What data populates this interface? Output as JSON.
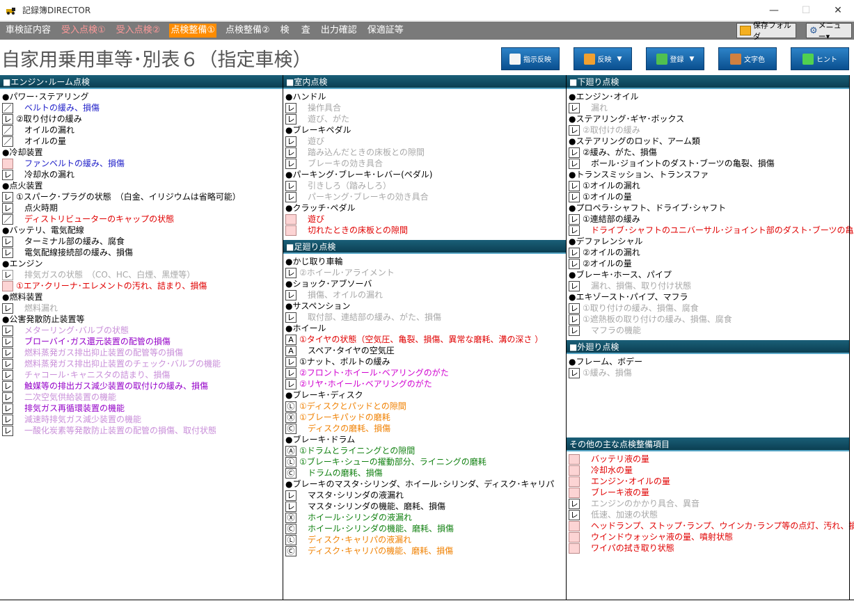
{
  "window": {
    "title": "記録簿DIRECTOR",
    "controls": [
      "—",
      "☐",
      "✕"
    ]
  },
  "menu": {
    "items": [
      {
        "label": "車検証内容",
        "style": "white"
      },
      {
        "label": "受入点検①",
        "style": "red"
      },
      {
        "label": "受入点検②",
        "style": "red"
      },
      {
        "label": "点検整備①",
        "style": "active"
      },
      {
        "label": "点検整備②",
        "style": "white"
      },
      {
        "label": "検　 査",
        "style": "white"
      },
      {
        "label": "出力確認",
        "style": "white"
      },
      {
        "label": "保適証等",
        "style": "white"
      }
    ],
    "folder_button": "保存フォルダ",
    "menu_button": "メニュー▾"
  },
  "page": {
    "title": "自家用乗用車等･別表６（指定車検）"
  },
  "toolbar": [
    {
      "label": "指示反映",
      "icon": "edit-icon",
      "color": "#f5f5f5",
      "dropdown": false
    },
    {
      "label": "反映",
      "icon": "rss-icon",
      "color": "#f0a030",
      "dropdown": true
    },
    {
      "label": "登録",
      "icon": "rss-icon",
      "color": "#50c050",
      "dropdown": true
    },
    {
      "label": "文字色",
      "icon": "palette-icon",
      "color": "#d08040",
      "dropdown": false
    },
    {
      "label": "ヒント",
      "icon": "chat-icon",
      "color": "#50d050",
      "dropdown": false
    }
  ],
  "columns": [
    [
      {
        "title": "■エンジン･ルーム点検",
        "groups": [
          {
            "label": "●パワー･ステアリング",
            "items": [
              {
                "mark": "／",
                "box": "n",
                "text": "　ベルトの緩み、損傷",
                "color": "blue"
              },
              {
                "mark": "レ",
                "box": "n",
                "text": "②取り付けの緩み",
                "color": "black"
              },
              {
                "mark": "／",
                "box": "n",
                "text": "　オイルの漏れ",
                "color": "black"
              },
              {
                "mark": "／",
                "box": "n",
                "text": "　オイルの量",
                "color": "black"
              }
            ]
          },
          {
            "label": "●冷却装置",
            "items": [
              {
                "mark": "",
                "box": "p",
                "text": "　ファンベルトの緩み、損傷",
                "color": "blue"
              },
              {
                "mark": "レ",
                "box": "n",
                "text": "　冷却水の漏れ",
                "color": "black"
              }
            ]
          },
          {
            "label": "●点火装置",
            "items": [
              {
                "mark": "レ",
                "box": "n",
                "text": "①スパーク･プラグの状態　（白金、イリジウムは省略可能）",
                "color": "black"
              },
              {
                "mark": "レ",
                "box": "n",
                "text": "　点火時期",
                "color": "black"
              },
              {
                "mark": "／",
                "box": "n",
                "text": "　ディストリビューターのキャップの状態",
                "color": "red"
              }
            ]
          },
          {
            "label": "●バッテリ、電気配線",
            "items": [
              {
                "mark": "レ",
                "box": "n",
                "text": "　ターミナル部の緩み、腐食",
                "color": "black"
              },
              {
                "mark": "レ",
                "box": "n",
                "text": "　電気配線接続部の緩み、損傷",
                "color": "black"
              }
            ]
          },
          {
            "label": "●エンジン",
            "items": [
              {
                "mark": "レ",
                "box": "l",
                "text": "　排気ガスの状態　（CO、HC、白煙、黒煙等）",
                "color": "gray"
              },
              {
                "mark": "",
                "box": "p",
                "text": "①エア･クリーナ･エレメントの汚れ、詰まり、損傷",
                "color": "red"
              }
            ]
          },
          {
            "label": "●燃料装置",
            "items": [
              {
                "mark": "レ",
                "box": "n",
                "text": "　燃料漏れ",
                "color": "gray"
              }
            ]
          },
          {
            "label": "●公害発散防止装置等",
            "items": [
              {
                "mark": "レ",
                "box": "n",
                "text": "　メターリング･バルブの状態",
                "color": "lpurple"
              },
              {
                "mark": "レ",
                "box": "n",
                "text": "　ブローバイ･ガス還元装置の配管の損傷",
                "color": "purple"
              },
              {
                "mark": "レ",
                "box": "n",
                "text": "　燃料蒸発ガス排出抑止装置の配管等の損傷",
                "color": "lpurple"
              },
              {
                "mark": "レ",
                "box": "n",
                "text": "　燃料蒸発ガス排出抑止装置のチェック･バルブの機能",
                "color": "lpurple"
              },
              {
                "mark": "レ",
                "box": "n",
                "text": "　チャコール･キャニスタの詰まり、損傷",
                "color": "lpurple"
              },
              {
                "mark": "レ",
                "box": "n",
                "text": "　触媒等の排出ガス減少装置の取付けの緩み、損傷",
                "color": "purple"
              },
              {
                "mark": "レ",
                "box": "n",
                "text": "　二次空気供給装置の機能",
                "color": "lpurple"
              },
              {
                "mark": "レ",
                "box": "n",
                "text": "　排気ガス再循環装置の機能",
                "color": "purple"
              },
              {
                "mark": "レ",
                "box": "n",
                "text": "　減速時排気ガス減少装置の機能",
                "color": "lpurple"
              },
              {
                "mark": "レ",
                "box": "n",
                "text": "　一酸化炭素等発散防止装置の配管の損傷、取付状態",
                "color": "lpurple"
              }
            ]
          }
        ]
      }
    ],
    [
      {
        "title": "■室内点検",
        "groups": [
          {
            "label": "●ハンドル",
            "items": [
              {
                "mark": "レ",
                "box": "n",
                "text": "　操作具合",
                "color": "gray"
              },
              {
                "mark": "レ",
                "box": "n",
                "text": "　遊び、がた",
                "color": "gray"
              }
            ]
          },
          {
            "label": "●ブレーキペダル",
            "items": [
              {
                "mark": "レ",
                "box": "n",
                "text": "　遊び",
                "color": "gray"
              },
              {
                "mark": "レ",
                "box": "n",
                "text": "　踏み込んだときの床板との隙間",
                "color": "gray"
              },
              {
                "mark": "レ",
                "box": "n",
                "text": "　ブレーキの効き具合",
                "color": "gray"
              }
            ]
          },
          {
            "label": "●パーキング･ブレーキ･レバー(ペダル)",
            "items": [
              {
                "mark": "レ",
                "box": "n",
                "text": "　引きしろ（踏みしろ）",
                "color": "gray"
              },
              {
                "mark": "レ",
                "box": "n",
                "text": "　パーキング･ブレーキの効き具合",
                "color": "gray"
              }
            ]
          },
          {
            "label": "●クラッチ･ペダル",
            "items": [
              {
                "mark": "",
                "box": "p",
                "text": "　遊び",
                "color": "red"
              },
              {
                "mark": "",
                "box": "p",
                "text": "　切れたときの床板との隙間",
                "color": "red"
              }
            ]
          }
        ]
      },
      {
        "title": "■足廻り点検",
        "groups": [
          {
            "label": "●かじ取り車輪",
            "items": [
              {
                "mark": "レ",
                "box": "n",
                "text": "②ホイール･アライメント",
                "color": "gray"
              }
            ]
          },
          {
            "label": "●ショック･アブソーバ",
            "items": [
              {
                "mark": "レ",
                "box": "n",
                "text": "　損傷、オイルの漏れ",
                "color": "gray"
              }
            ]
          },
          {
            "label": "●サスペンション",
            "items": [
              {
                "mark": "レ",
                "box": "n",
                "text": "　取付部、連結部の緩み、がた、損傷",
                "color": "gray"
              }
            ]
          },
          {
            "label": "●ホイール",
            "items": [
              {
                "mark": "A",
                "box": "n",
                "text": "①タイヤの状態（空気圧、亀裂、損傷、異常な磨耗、溝の深さ ）",
                "color": "red"
              },
              {
                "mark": "A",
                "box": "n",
                "text": "　スペア･タイヤの空気圧",
                "color": "black"
              },
              {
                "mark": "レ",
                "box": "n",
                "text": "①ナット、ボルトの緩み",
                "color": "black"
              },
              {
                "mark": "レ",
                "box": "n",
                "text": "②フロント･ホイール･ベアリングのがた",
                "color": "magenta"
              },
              {
                "mark": "レ",
                "box": "n",
                "text": "②リヤ･ホイール･ベアリングのがた",
                "color": "magenta"
              }
            ]
          },
          {
            "label": "●ブレーキ･ディスク",
            "items": [
              {
                "mark": "Ⓛ",
                "box": "n",
                "text": "①ディスクとパッドとの隙間",
                "color": "orange"
              },
              {
                "mark": "Ⓧ",
                "box": "n",
                "text": "①ブレーキパッドの磨耗",
                "color": "orange"
              },
              {
                "mark": "Ⓒ",
                "box": "n",
                "text": "　ディスクの磨耗、損傷",
                "color": "orange"
              }
            ]
          },
          {
            "label": "●ブレーキ･ドラム",
            "items": [
              {
                "mark": "Ⓐ",
                "box": "n",
                "text": "①ドラムとライニングとの隙間",
                "color": "green"
              },
              {
                "mark": "Ⓛ",
                "box": "n",
                "text": "①ブレーキ･シューの擢動部分、ライニングの磨耗",
                "color": "green"
              },
              {
                "mark": "Ⓒ",
                "box": "n",
                "text": "　ドラムの磨耗、損傷",
                "color": "green"
              }
            ]
          },
          {
            "label": "●ブレーキのマスタ･シリンダ、ホイール･シリンダ、ディスク･キャリパ",
            "items": [
              {
                "mark": "レ",
                "box": "n",
                "text": "　マスタ･シリンダの液漏れ",
                "color": "black"
              },
              {
                "mark": "レ",
                "box": "n",
                "text": "　マスタ･シリンダの機能、磨耗、損傷",
                "color": "black"
              },
              {
                "mark": "Ⓧ",
                "box": "n",
                "text": "　ホイール･シリンダの液漏れ",
                "color": "green"
              },
              {
                "mark": "Ⓒ",
                "box": "n",
                "text": "　ホイール･シリンダの機能、磨耗、損傷",
                "color": "green"
              },
              {
                "mark": "Ⓛ",
                "box": "n",
                "text": "　ディスク･キャリパの液漏れ",
                "color": "orange"
              },
              {
                "mark": "Ⓒ",
                "box": "n",
                "text": "　ディスク･キャリパの機能、磨耗、損傷",
                "color": "orange"
              }
            ]
          }
        ]
      }
    ],
    [
      {
        "title": "■下廻り点検",
        "groups": [
          {
            "label": "●エンジン･オイル",
            "items": [
              {
                "mark": "レ",
                "box": "n",
                "text": "　漏れ",
                "color": "gray"
              }
            ]
          },
          {
            "label": "●ステアリング･ギヤ･ボックス",
            "items": [
              {
                "mark": "レ",
                "box": "n",
                "text": "②取付けの緩み",
                "color": "gray"
              }
            ]
          },
          {
            "label": "●ステアリングのロッド、アーム類",
            "items": [
              {
                "mark": "レ",
                "box": "n",
                "text": "②緩み、がた、損傷",
                "color": "black"
              },
              {
                "mark": "レ",
                "box": "n",
                "text": "　ボール･ジョイントのダスト･ブーツの亀裂、損傷",
                "color": "black"
              }
            ]
          },
          {
            "label": "●トランスミッション、トランスファ",
            "items": [
              {
                "mark": "レ",
                "box": "n",
                "text": "①オイルの漏れ",
                "color": "black"
              },
              {
                "mark": "レ",
                "box": "n",
                "text": "①オイルの量",
                "color": "black"
              }
            ]
          },
          {
            "label": "●プロペラ･シャフト、ドライブ･シャフト",
            "items": [
              {
                "mark": "レ",
                "box": "n",
                "text": "①連結部の緩み",
                "color": "black"
              },
              {
                "mark": "レ",
                "box": "n",
                "text": "　ドライブ･シャフトのユニバーサル･ジョイント部のダスト･ブーツの亀裂、損傷",
                "color": "red"
              }
            ]
          },
          {
            "label": "●デファレンシャル",
            "items": [
              {
                "mark": "レ",
                "box": "n",
                "text": "②オイルの漏れ",
                "color": "black"
              },
              {
                "mark": "レ",
                "box": "n",
                "text": "②オイルの量",
                "color": "black"
              }
            ]
          },
          {
            "label": "●ブレーキ･ホース、パイプ",
            "items": [
              {
                "mark": "レ",
                "box": "n",
                "text": "　漏れ、損傷、取り付け状態",
                "color": "gray"
              }
            ]
          },
          {
            "label": "●エキゾースト･パイプ、マフラ",
            "items": [
              {
                "mark": "レ",
                "box": "n",
                "text": "①取り付けの緩み、損傷、腐食",
                "color": "gray"
              },
              {
                "mark": "レ",
                "box": "n",
                "text": "①遮熱板の取り付けの緩み、損傷、腐食",
                "color": "gray"
              },
              {
                "mark": "レ",
                "box": "n",
                "text": "　マフラの機能",
                "color": "gray"
              }
            ]
          }
        ]
      },
      {
        "title": "■外廻り点検",
        "groups": [
          {
            "label": "●フレーム、ボデー",
            "items": [
              {
                "mark": "レ",
                "box": "n",
                "text": "①緩み、損傷",
                "color": "gray"
              }
            ]
          }
        ]
      },
      {
        "title": "その他の主な点検整備項目",
        "groups": [
          {
            "label": "",
            "items": [
              {
                "mark": "",
                "box": "p",
                "text": "　バッテリ液の量",
                "color": "red"
              },
              {
                "mark": "",
                "box": "p",
                "text": "　冷却水の量",
                "color": "red"
              },
              {
                "mark": "",
                "box": "p",
                "text": "　エンジン･オイルの量",
                "color": "red"
              },
              {
                "mark": "",
                "box": "p",
                "text": "　ブレーキ液の量",
                "color": "red"
              },
              {
                "mark": "レ",
                "box": "n",
                "text": "　エンジンのかかり具合、異音",
                "color": "gray"
              },
              {
                "mark": "レ",
                "box": "n",
                "text": "　低速、加速の状態",
                "color": "gray"
              },
              {
                "mark": "",
                "box": "p",
                "text": "　ヘッドランプ、ストップ･ランプ、ウインカ･ランプ等の点灯、汚れ、損傷",
                "color": "red"
              },
              {
                "mark": "",
                "box": "p",
                "text": "　ウインドウォッシャ液の量、噴射状態",
                "color": "red"
              },
              {
                "mark": "",
                "box": "p",
                "text": "　ワイパの拭き取り状態",
                "color": "red"
              }
            ]
          }
        ]
      }
    ]
  ]
}
